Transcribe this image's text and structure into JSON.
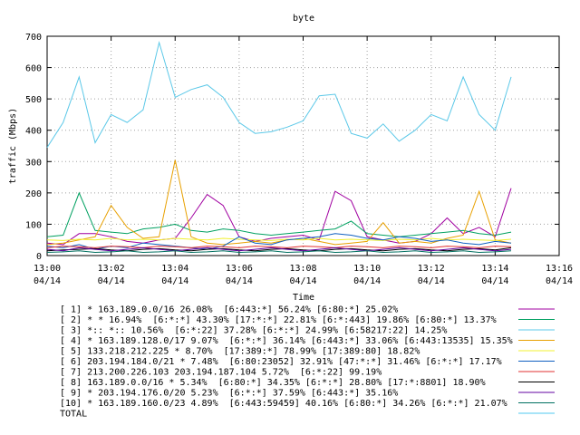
{
  "chart_data": {
    "type": "line",
    "title": "byte",
    "xlabel": "Time",
    "ylabel": "traffic (Mbps)",
    "ylim": [
      0,
      700
    ],
    "yticks": [
      "0",
      "100",
      "200",
      "300",
      "400",
      "500",
      "600",
      "700"
    ],
    "xlim": [
      "13:00",
      "13:16"
    ],
    "xticks": [
      {
        "time": "13:00",
        "date": "04/14"
      },
      {
        "time": "13:02",
        "date": "04/14"
      },
      {
        "time": "13:04",
        "date": "04/14"
      },
      {
        "time": "13:06",
        "date": "04/14"
      },
      {
        "time": "13:08",
        "date": "04/14"
      },
      {
        "time": "13:10",
        "date": "04/14"
      },
      {
        "time": "13:12",
        "date": "04/14"
      },
      {
        "time": "13:14",
        "date": "04/14"
      },
      {
        "time": "13:16",
        "date": "04/14"
      }
    ],
    "grid": true,
    "legend_position": "bottom",
    "x": [
      "13:00:00",
      "13:00:30",
      "13:01:00",
      "13:01:30",
      "13:02:00",
      "13:02:30",
      "13:03:00",
      "13:03:30",
      "13:04:00",
      "13:04:30",
      "13:05:00",
      "13:05:30",
      "13:06:00",
      "13:06:30",
      "13:07:00",
      "13:07:30",
      "13:08:00",
      "13:08:30",
      "13:09:00",
      "13:09:30",
      "13:10:00",
      "13:10:30",
      "13:11:00",
      "13:11:30",
      "13:12:00",
      "13:12:30",
      "13:13:00",
      "13:13:30",
      "13:14:00",
      "13:14:30"
    ],
    "series": [
      {
        "name": "[ 1] * 163.189.0.0/16 26.08%  [6:443:*] 56.24% [6:80:*] 25.02%",
        "color": "#a000a0",
        "values": [
          40,
          35,
          70,
          70,
          60,
          45,
          40,
          50,
          55,
          120,
          195,
          160,
          60,
          45,
          55,
          60,
          65,
          50,
          205,
          175,
          60,
          50,
          40,
          45,
          70,
          120,
          70,
          90,
          60,
          215
        ]
      },
      {
        "name": "[ 2] * * 16.94%  [6:*:*] 43.30% [17:*:*] 22.81% [6:*:443] 19.86% [6:80:*] 13.37%",
        "color": "#00a060",
        "values": [
          60,
          65,
          200,
          80,
          75,
          70,
          85,
          90,
          100,
          80,
          75,
          85,
          80,
          70,
          65,
          70,
          75,
          80,
          85,
          110,
          70,
          65,
          60,
          65,
          70,
          75,
          80,
          70,
          65,
          75
        ]
      },
      {
        "name": "[ 3] *:: *:: 10.56%  [6:*:22] 37.28% [6:*:*] 24.99% [6:58217:22] 14.25%",
        "color": "#5bc8e8",
        "values": [
          345,
          425,
          570,
          360,
          450,
          425,
          465,
          680,
          505,
          530,
          545,
          505,
          425,
          390,
          395,
          410,
          430,
          510,
          515,
          390,
          375,
          420,
          365,
          400,
          450,
          430,
          570,
          450,
          400,
          570
        ]
      },
      {
        "name": "[ 4] * 163.189.128.0/17 9.07%  [6:*:*] 36.14% [6:443:*] 33.06% [6:443:13535] 15.35%",
        "color": "#e8a000",
        "values": [
          35,
          40,
          50,
          60,
          160,
          90,
          55,
          60,
          305,
          60,
          40,
          35,
          40,
          45,
          40,
          50,
          55,
          45,
          35,
          40,
          45,
          105,
          40,
          45,
          40,
          55,
          65,
          205,
          50,
          40
        ]
      },
      {
        "name": "[ 5] 133.218.212.225 * 8.70%  [17:389:*] 78.99% [17:389:80] 18.82%",
        "color": "#f0f030",
        "values": [
          50,
          48,
          52,
          50,
          55,
          50,
          52,
          50,
          55,
          52,
          50,
          55,
          52,
          50,
          48,
          52,
          50,
          55,
          50,
          52,
          50,
          48,
          52,
          50,
          55,
          50,
          52,
          50,
          48,
          52
        ]
      },
      {
        "name": "[ 6] 203.194.184.0/21 * 7.48%  [6:80:23052] 32.91% [47:*:*] 31.46% [6:*:*] 17.17%",
        "color": "#1060c0",
        "values": [
          30,
          25,
          35,
          20,
          30,
          25,
          40,
          35,
          30,
          25,
          20,
          30,
          60,
          40,
          35,
          50,
          55,
          60,
          70,
          65,
          55,
          50,
          60,
          55,
          45,
          50,
          40,
          35,
          45,
          40
        ]
      },
      {
        "name": "[ 7] 213.200.226.103 203.194.187.104 5.72%  [6:*:22] 99.19%",
        "color": "#e03030",
        "values": [
          25,
          30,
          28,
          25,
          30,
          28,
          25,
          30,
          28,
          25,
          30,
          28,
          25,
          30,
          28,
          25,
          30,
          28,
          25,
          30,
          28,
          25,
          30,
          28,
          25,
          30,
          28,
          25,
          30,
          28
        ]
      },
      {
        "name": "[ 8] 163.189.0.0/16 * 5.34%  [6:80:*] 34.35% [6:*:*] 28.80% [17:*:8801] 18.90%",
        "color": "#000000",
        "values": [
          15,
          18,
          20,
          22,
          18,
          15,
          20,
          22,
          18,
          15,
          20,
          22,
          18,
          15,
          20,
          22,
          18,
          15,
          20,
          22,
          18,
          15,
          20,
          22,
          18,
          15,
          20,
          22,
          18,
          25
        ]
      },
      {
        "name": "[ 9] * 203.194.176.0/20 5.23%  [6:*:*] 37.59% [6:443:*] 35.16%",
        "color": "#6000a0",
        "values": [
          20,
          15,
          25,
          20,
          15,
          20,
          25,
          20,
          15,
          20,
          25,
          20,
          15,
          20,
          25,
          20,
          15,
          20,
          25,
          20,
          15,
          20,
          25,
          20,
          15,
          20,
          25,
          20,
          15,
          20
        ]
      },
      {
        "name": "[10] * 163.189.160.0/23 4.89%  [6:443:59459] 40.16% [6:80:*] 34.26% [6:*:*] 21.07%",
        "color": "#007060",
        "values": [
          10,
          12,
          15,
          10,
          12,
          15,
          10,
          12,
          15,
          10,
          12,
          15,
          10,
          12,
          15,
          10,
          12,
          15,
          10,
          12,
          15,
          10,
          12,
          15,
          10,
          12,
          15,
          10,
          12,
          15
        ]
      },
      {
        "name": "TOTAL",
        "color": "#50c8f0",
        "values": []
      }
    ]
  }
}
